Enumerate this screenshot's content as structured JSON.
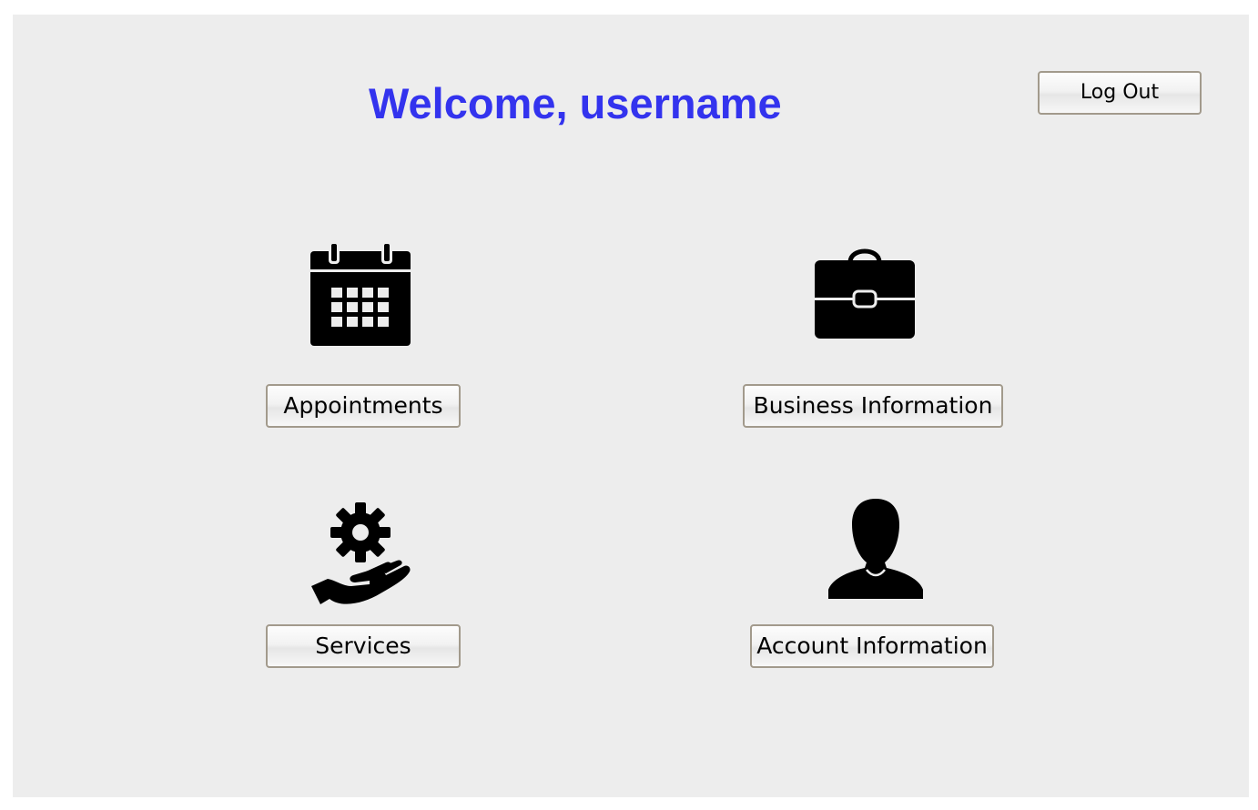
{
  "header": {
    "welcome_text": "Welcome, username",
    "logout_label": "Log Out",
    "title_color": "#3333ee"
  },
  "menu": {
    "appointments": {
      "label": "Appointments",
      "icon": "calendar-icon"
    },
    "business_information": {
      "label": "Business Information",
      "icon": "briefcase-icon"
    },
    "services": {
      "label": "Services",
      "icon": "hand-gear-icon"
    },
    "account_information": {
      "label": "Account Information",
      "icon": "person-icon"
    }
  },
  "colors": {
    "background": "#ededed",
    "button_border": "#a29a8c",
    "icon": "#000000"
  }
}
